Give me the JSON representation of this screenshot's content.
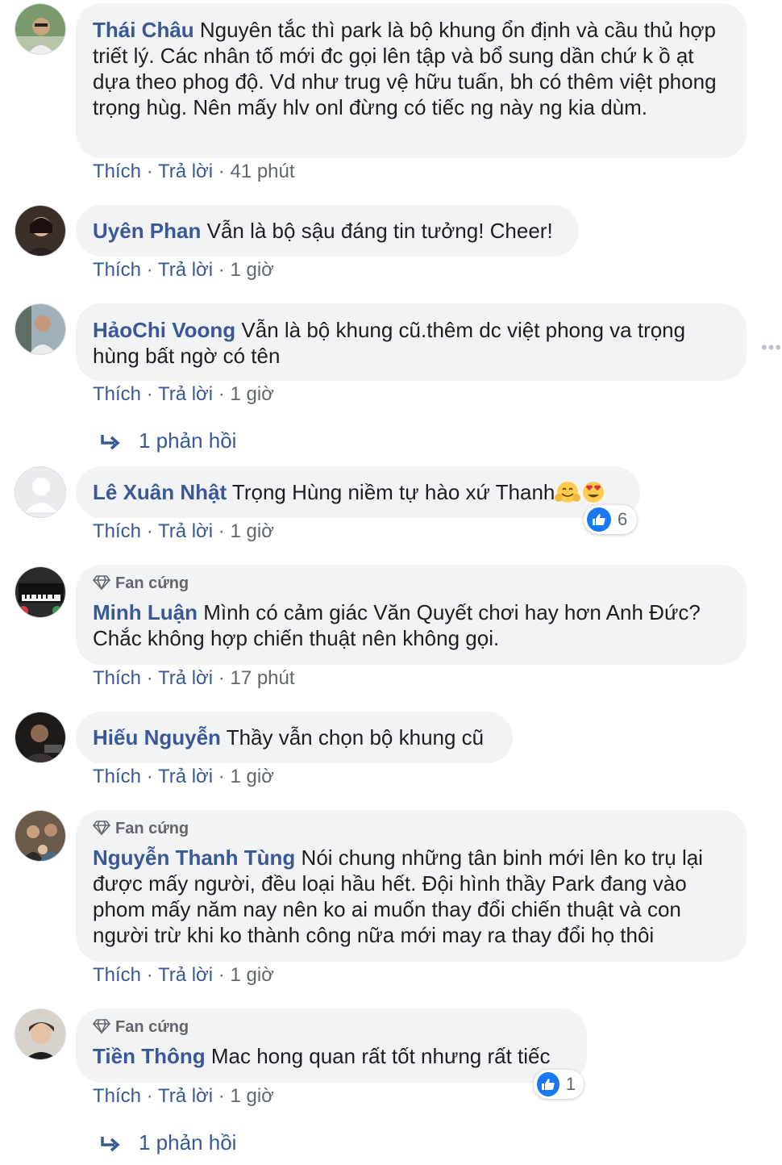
{
  "ui": {
    "like_label": "Thích",
    "reply_label": "Trả lời",
    "separator": "·",
    "fan_badge": "Fan cứng",
    "more_icon": "more-horizontal-icon",
    "colors": {
      "link": "#385898",
      "bubble": "#f2f3f5",
      "meta": "#606770",
      "like_blue": "#1877f2"
    }
  },
  "comments": [
    {
      "author": "Thái Châu",
      "text": "Nguyên tắc thì park là bộ khung ổn định và cầu thủ hợp triết lý. Các nhân tố mới đc gọi lên tập và bổ sung dần chứ k ồ ạt dựa theo phog độ. Vd như trug vệ hữu tuấn, bh có thêm việt phong trọng hùg. Nên mấy hlv onl đừng có tiếc ng này ng kia dùm.",
      "time": "41 phút"
    },
    {
      "author": "Uyên Phan",
      "text": "Vẫn là bộ sậu đáng tin tưởng! Cheer!",
      "time": "1 giờ"
    },
    {
      "author": "HảoChi Voong",
      "text": "Vẫn là bộ khung cũ.thêm dc việt phong va trọng hùng bất ngờ có tên",
      "time": "1 giờ",
      "replies": "1 phản hồi"
    },
    {
      "author": "Lê Xuân Nhật",
      "text": "Trọng Hùng niềm tự hào xứ Thanh",
      "time": "1 giờ",
      "reactions": "6"
    },
    {
      "author": "Minh Luận",
      "text": "Mình có cảm giác Văn Quyết chơi hay hơn Anh Đức? Chắc không hợp chiến thuật nên không gọi.",
      "time": "17 phút"
    },
    {
      "author": "Hiếu Nguyễn",
      "text": "Thầy vẫn chọn bộ khung cũ",
      "time": "1 giờ"
    },
    {
      "author": "Nguyễn Thanh Tùng",
      "text": "Nói chung những tân binh mới lên ko trụ lại được mấy người, đều loại hầu hết. Đội hình thầy Park đang vào phom mấy năm nay nên ko ai muốn thay đổi chiến thuật và con người trừ khi ko thành công nữa mới may ra thay đổi họ thôi",
      "time": "1 giờ"
    },
    {
      "author": "Tiền Thông",
      "text": "Mac hong quan rất tốt nhưng rất tiếc",
      "time": "1 giờ",
      "reactions": "1",
      "replies": "1 phản hồi"
    }
  ]
}
